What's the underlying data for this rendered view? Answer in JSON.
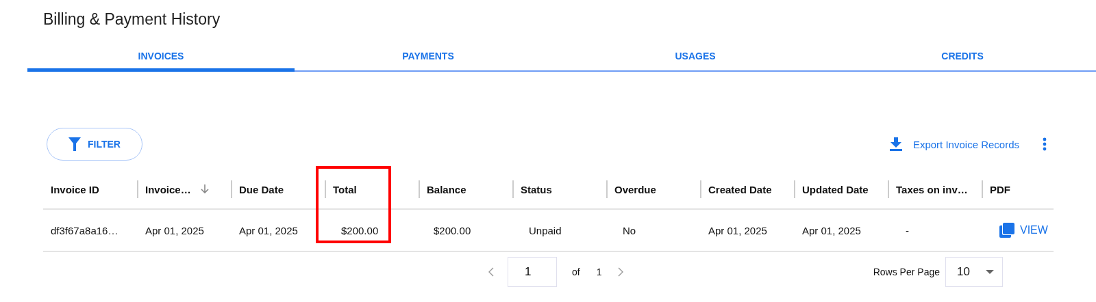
{
  "title": "Billing & Payment History",
  "tabs": [
    {
      "label": "INVOICES",
      "selected": true
    },
    {
      "label": "PAYMENTS",
      "selected": false
    },
    {
      "label": "USAGES",
      "selected": false
    },
    {
      "label": "CREDITS",
      "selected": false
    }
  ],
  "toolbar": {
    "filter_button": "FILTER",
    "export_link": "Export Invoice Records"
  },
  "table": {
    "columns": [
      {
        "label": "Invoice ID",
        "sorted": false,
        "highlighted": false
      },
      {
        "label": "Invoice…",
        "sorted": true,
        "highlighted": false
      },
      {
        "label": "Due Date",
        "sorted": false,
        "highlighted": false
      },
      {
        "label": "Total",
        "sorted": false,
        "highlighted": true
      },
      {
        "label": "Balance",
        "sorted": false,
        "highlighted": false
      },
      {
        "label": "Status",
        "sorted": false,
        "highlighted": false
      },
      {
        "label": "Overdue",
        "sorted": false,
        "highlighted": false
      },
      {
        "label": "Created Date",
        "sorted": false,
        "highlighted": false
      },
      {
        "label": "Updated Date",
        "sorted": false,
        "highlighted": false
      },
      {
        "label": "Taxes on inv…",
        "sorted": false,
        "highlighted": false
      },
      {
        "label": "PDF",
        "sorted": false,
        "highlighted": false
      }
    ],
    "rows": [
      {
        "cells": [
          "df3f67a8a16…",
          "Apr 01, 2025",
          "Apr 01, 2025",
          "$200.00",
          "$200.00",
          "Unpaid",
          "No",
          "Apr 01, 2025",
          "Apr 01, 2025",
          "-"
        ],
        "pdf_link": "VIEW"
      }
    ]
  },
  "pagination": {
    "page": "1",
    "of_label": "of",
    "total_pages": "1",
    "rows_per_page_label": "Rows Per Page",
    "rows_per_page": "10"
  }
}
